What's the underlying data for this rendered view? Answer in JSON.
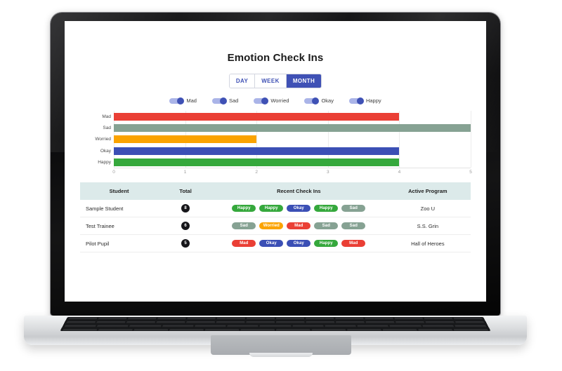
{
  "app": {
    "title": "Emotion Check Ins"
  },
  "range_selector": {
    "options": [
      {
        "label": "DAY",
        "active": false
      },
      {
        "label": "WEEK",
        "active": false
      },
      {
        "label": "MONTH",
        "active": true
      }
    ]
  },
  "legend": {
    "items": [
      {
        "label": "Mad"
      },
      {
        "label": "Sad"
      },
      {
        "label": "Worried"
      },
      {
        "label": "Okay"
      },
      {
        "label": "Happy"
      }
    ]
  },
  "emotion_colors": {
    "Mad": "#ea3f35",
    "Sad": "#86a293",
    "Worried": "#fba300",
    "Okay": "#3b4fb5",
    "Happy": "#35a83c"
  },
  "chart_data": {
    "type": "bar",
    "orientation": "horizontal",
    "title": "Emotion Check Ins",
    "categories": [
      "Mad",
      "Sad",
      "Worried",
      "Okay",
      "Happy"
    ],
    "values": [
      4,
      5,
      2,
      4,
      4
    ],
    "colors": [
      "#ea3f35",
      "#86a293",
      "#fba300",
      "#3b4fb5",
      "#35a83c"
    ],
    "xlabel": "",
    "ylabel": "",
    "xlim": [
      0,
      5
    ],
    "xticks": [
      0,
      1,
      2,
      3,
      4,
      5
    ],
    "grid": true,
    "legend_position": "top"
  },
  "table": {
    "headers": {
      "student": "Student",
      "total": "Total",
      "recent": "Recent Check Ins",
      "program": "Active Program"
    },
    "rows": [
      {
        "student": "Sample Student",
        "total": "8",
        "recent": [
          "Happy",
          "Happy",
          "Okay",
          "Happy",
          "Sad"
        ],
        "program": "Zoo U"
      },
      {
        "student": "Test Trainee",
        "total": "6",
        "recent": [
          "Sad",
          "Worried",
          "Mad",
          "Sad",
          "Sad"
        ],
        "program": "S.S. Grin"
      },
      {
        "student": "Pilot Pupil",
        "total": "5",
        "recent": [
          "Mad",
          "Okay",
          "Okay",
          "Happy",
          "Mad"
        ],
        "program": "Hall of Heroes"
      }
    ]
  }
}
